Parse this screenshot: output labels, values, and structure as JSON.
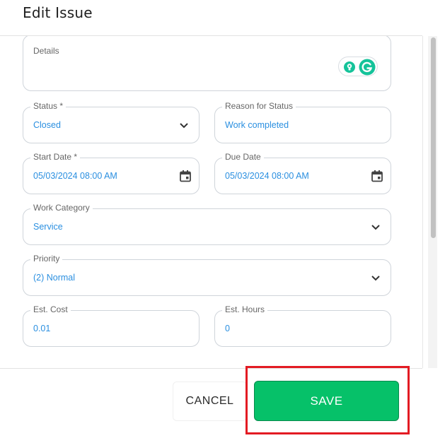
{
  "dialog": {
    "title": "Edit Issue"
  },
  "form": {
    "details": {
      "label": "Details",
      "value": ""
    },
    "status": {
      "label": "Status *",
      "value": "Closed"
    },
    "reason": {
      "label": "Reason for Status",
      "value": "Work completed"
    },
    "start_date": {
      "label": "Start Date *",
      "value": "05/03/2024 08:00 AM"
    },
    "due_date": {
      "label": "Due Date",
      "value": "05/03/2024 08:00 AM"
    },
    "work_category": {
      "label": "Work Category",
      "value": "Service"
    },
    "priority": {
      "label": "Priority",
      "value": "(2) Normal"
    },
    "est_cost": {
      "label": "Est. Cost",
      "value": "0.01"
    },
    "est_hours": {
      "label": "Est. Hours",
      "value": "0"
    }
  },
  "actions": {
    "cancel_label": "CANCEL",
    "save_label": "SAVE"
  },
  "icons": {
    "dropdown": "chevron-down-icon",
    "date": "calendar-icon",
    "grammarly_assistant": "lightbulb-icon",
    "grammarly_logo": "grammarly-icon"
  },
  "colors": {
    "value_text": "#2a8fe0",
    "save_button": "#06c169",
    "highlight_border": "#e31b23",
    "grammarly_green": "#15c39a"
  }
}
